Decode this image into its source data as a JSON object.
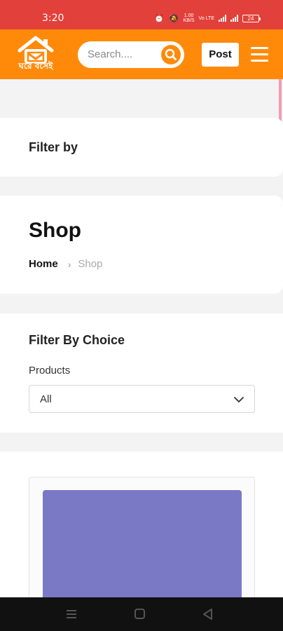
{
  "status_bar": {
    "time": "3:20",
    "alarm_icon": "alarm-icon",
    "mute_icon": "bell-off-icon",
    "net_speed_top": "1.00",
    "net_speed_bottom": "KB/S",
    "network": "Vo LTE",
    "battery_level": "24",
    "color": "#e2403a"
  },
  "header": {
    "background": "#ff8a0a",
    "logo_text": "ঘরে বসেই",
    "search": {
      "placeholder": "Search....",
      "icon": "search-icon"
    },
    "post_label": "Post",
    "menu_icon": "hamburger-menu-icon"
  },
  "filter_by": {
    "title": "Filter by"
  },
  "shop": {
    "title": "Shop",
    "breadcrumb": {
      "home": "Home",
      "separator": "›",
      "current": "Shop"
    }
  },
  "filter_choice": {
    "title": "Filter By Choice",
    "products_label": "Products",
    "products_selected": "All",
    "chevron_icon": "chevron-down-icon"
  },
  "product": {
    "image_color": "#7a79c6"
  },
  "nav_bar": {
    "menu_icon": "recent-apps-icon",
    "home_icon": "home-square-icon",
    "back_icon": "back-triangle-icon"
  }
}
